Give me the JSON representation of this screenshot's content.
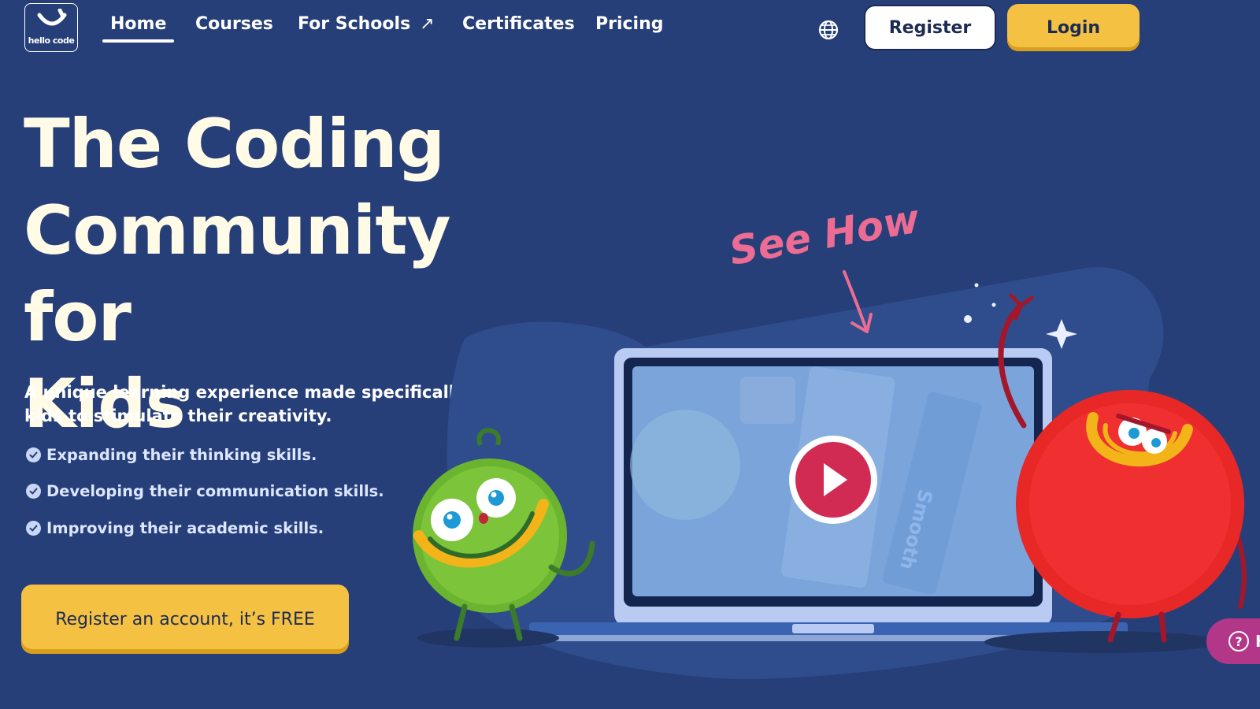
{
  "nav": {
    "logo_text": "hello code",
    "links": [
      {
        "label": "Home"
      },
      {
        "label": "Courses"
      },
      {
        "label": "For Schools"
      },
      {
        "label": "Certificates"
      },
      {
        "label": "Pricing"
      }
    ],
    "register_label": "Register",
    "login_label": "Login"
  },
  "hero": {
    "title_line1": "The Coding",
    "title_line2": "Community for",
    "title_line3": "Kids",
    "subtitle": "A unique learning experience made specifically for kids to stimulate their creativity.",
    "bullets": [
      "Expanding their thinking skills.",
      "Developing their communication skills.",
      "Improving their academic skills."
    ],
    "cta_label": "Register an account, it’s FREE"
  },
  "illustration": {
    "see_how": "See How",
    "laptop_sticker": "Smooth",
    "help_label": "H"
  },
  "colors": {
    "background": "#273f78",
    "accent_yellow": "#f4c143",
    "pink": "#ec6c93",
    "play_red": "#d12b53",
    "green_monster": "#6ab42f",
    "red_monster": "#e82727",
    "help_purple": "#b23788"
  },
  "icons": {
    "globe": "globe-icon",
    "check": "check-circle-icon",
    "play": "play-icon",
    "external": "external-arrow-icon",
    "help": "question-icon"
  }
}
